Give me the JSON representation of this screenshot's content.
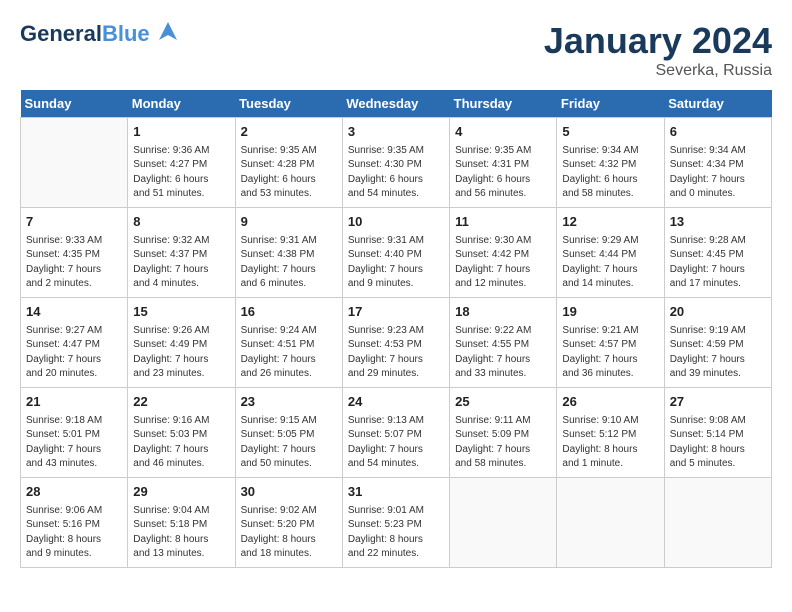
{
  "header": {
    "logo_general": "General",
    "logo_blue": "Blue",
    "month_title": "January 2024",
    "location": "Severka, Russia"
  },
  "weekdays": [
    "Sunday",
    "Monday",
    "Tuesday",
    "Wednesday",
    "Thursday",
    "Friday",
    "Saturday"
  ],
  "weeks": [
    [
      {
        "day": "",
        "info": ""
      },
      {
        "day": "1",
        "info": "Sunrise: 9:36 AM\nSunset: 4:27 PM\nDaylight: 6 hours\nand 51 minutes."
      },
      {
        "day": "2",
        "info": "Sunrise: 9:35 AM\nSunset: 4:28 PM\nDaylight: 6 hours\nand 53 minutes."
      },
      {
        "day": "3",
        "info": "Sunrise: 9:35 AM\nSunset: 4:30 PM\nDaylight: 6 hours\nand 54 minutes."
      },
      {
        "day": "4",
        "info": "Sunrise: 9:35 AM\nSunset: 4:31 PM\nDaylight: 6 hours\nand 56 minutes."
      },
      {
        "day": "5",
        "info": "Sunrise: 9:34 AM\nSunset: 4:32 PM\nDaylight: 6 hours\nand 58 minutes."
      },
      {
        "day": "6",
        "info": "Sunrise: 9:34 AM\nSunset: 4:34 PM\nDaylight: 7 hours\nand 0 minutes."
      }
    ],
    [
      {
        "day": "7",
        "info": "Sunrise: 9:33 AM\nSunset: 4:35 PM\nDaylight: 7 hours\nand 2 minutes."
      },
      {
        "day": "8",
        "info": "Sunrise: 9:32 AM\nSunset: 4:37 PM\nDaylight: 7 hours\nand 4 minutes."
      },
      {
        "day": "9",
        "info": "Sunrise: 9:31 AM\nSunset: 4:38 PM\nDaylight: 7 hours\nand 6 minutes."
      },
      {
        "day": "10",
        "info": "Sunrise: 9:31 AM\nSunset: 4:40 PM\nDaylight: 7 hours\nand 9 minutes."
      },
      {
        "day": "11",
        "info": "Sunrise: 9:30 AM\nSunset: 4:42 PM\nDaylight: 7 hours\nand 12 minutes."
      },
      {
        "day": "12",
        "info": "Sunrise: 9:29 AM\nSunset: 4:44 PM\nDaylight: 7 hours\nand 14 minutes."
      },
      {
        "day": "13",
        "info": "Sunrise: 9:28 AM\nSunset: 4:45 PM\nDaylight: 7 hours\nand 17 minutes."
      }
    ],
    [
      {
        "day": "14",
        "info": "Sunrise: 9:27 AM\nSunset: 4:47 PM\nDaylight: 7 hours\nand 20 minutes."
      },
      {
        "day": "15",
        "info": "Sunrise: 9:26 AM\nSunset: 4:49 PM\nDaylight: 7 hours\nand 23 minutes."
      },
      {
        "day": "16",
        "info": "Sunrise: 9:24 AM\nSunset: 4:51 PM\nDaylight: 7 hours\nand 26 minutes."
      },
      {
        "day": "17",
        "info": "Sunrise: 9:23 AM\nSunset: 4:53 PM\nDaylight: 7 hours\nand 29 minutes."
      },
      {
        "day": "18",
        "info": "Sunrise: 9:22 AM\nSunset: 4:55 PM\nDaylight: 7 hours\nand 33 minutes."
      },
      {
        "day": "19",
        "info": "Sunrise: 9:21 AM\nSunset: 4:57 PM\nDaylight: 7 hours\nand 36 minutes."
      },
      {
        "day": "20",
        "info": "Sunrise: 9:19 AM\nSunset: 4:59 PM\nDaylight: 7 hours\nand 39 minutes."
      }
    ],
    [
      {
        "day": "21",
        "info": "Sunrise: 9:18 AM\nSunset: 5:01 PM\nDaylight: 7 hours\nand 43 minutes."
      },
      {
        "day": "22",
        "info": "Sunrise: 9:16 AM\nSunset: 5:03 PM\nDaylight: 7 hours\nand 46 minutes."
      },
      {
        "day": "23",
        "info": "Sunrise: 9:15 AM\nSunset: 5:05 PM\nDaylight: 7 hours\nand 50 minutes."
      },
      {
        "day": "24",
        "info": "Sunrise: 9:13 AM\nSunset: 5:07 PM\nDaylight: 7 hours\nand 54 minutes."
      },
      {
        "day": "25",
        "info": "Sunrise: 9:11 AM\nSunset: 5:09 PM\nDaylight: 7 hours\nand 58 minutes."
      },
      {
        "day": "26",
        "info": "Sunrise: 9:10 AM\nSunset: 5:12 PM\nDaylight: 8 hours\nand 1 minute."
      },
      {
        "day": "27",
        "info": "Sunrise: 9:08 AM\nSunset: 5:14 PM\nDaylight: 8 hours\nand 5 minutes."
      }
    ],
    [
      {
        "day": "28",
        "info": "Sunrise: 9:06 AM\nSunset: 5:16 PM\nDaylight: 8 hours\nand 9 minutes."
      },
      {
        "day": "29",
        "info": "Sunrise: 9:04 AM\nSunset: 5:18 PM\nDaylight: 8 hours\nand 13 minutes."
      },
      {
        "day": "30",
        "info": "Sunrise: 9:02 AM\nSunset: 5:20 PM\nDaylight: 8 hours\nand 18 minutes."
      },
      {
        "day": "31",
        "info": "Sunrise: 9:01 AM\nSunset: 5:23 PM\nDaylight: 8 hours\nand 22 minutes."
      },
      {
        "day": "",
        "info": ""
      },
      {
        "day": "",
        "info": ""
      },
      {
        "day": "",
        "info": ""
      }
    ]
  ]
}
